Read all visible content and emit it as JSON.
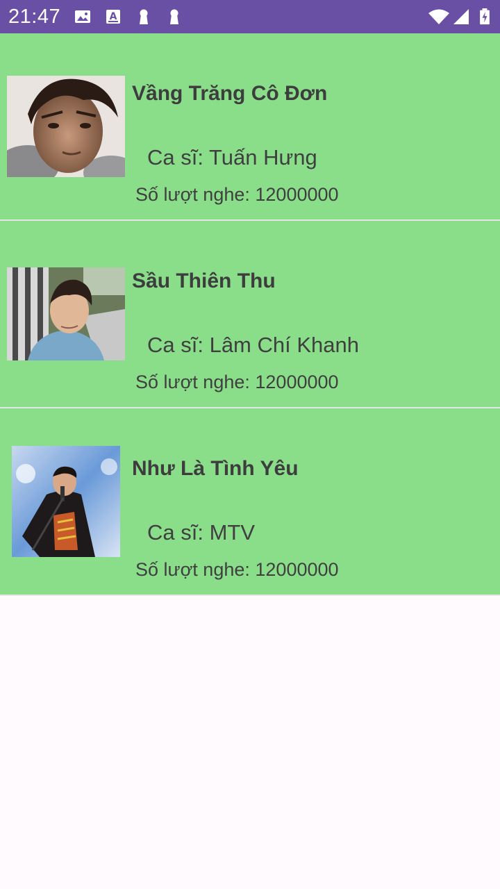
{
  "status_bar": {
    "time": "21:47",
    "icons": [
      "image-icon",
      "a-notification-icon",
      "keyhole-icon",
      "keyhole-icon",
      "wifi-icon",
      "cellular-signal-icon",
      "battery-icon"
    ],
    "background": "#6a50a4"
  },
  "songs": [
    {
      "title": "Vầng Trăng Cô Đơn",
      "singer_text": "Ca sĩ: Tuấn Hưng",
      "plays_label": "Số lượt nghe:",
      "plays_value": "12000000"
    },
    {
      "title": "Sầu Thiên Thu",
      "singer_text": "Ca sĩ: Lâm Chí Khanh",
      "plays_label": "Số lượt nghe:",
      "plays_value": "12000000"
    },
    {
      "title": "Như Là Tình Yêu",
      "singer_text": "Ca sĩ: MTV",
      "plays_label": "Số lượt nghe:",
      "plays_value": "12000000"
    }
  ],
  "colors": {
    "row_background": "#8ade8a",
    "divider": "#e4e4e4",
    "page_background": "#fffafd",
    "text": "#3d3d3d"
  }
}
